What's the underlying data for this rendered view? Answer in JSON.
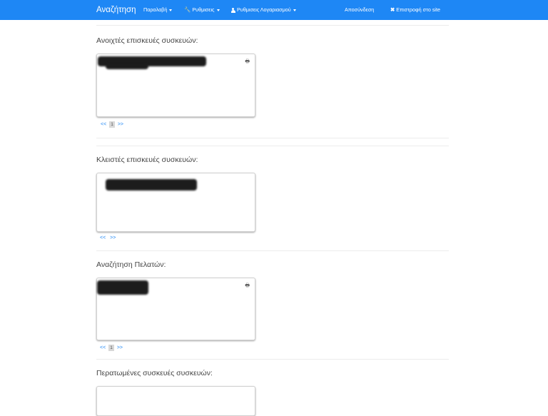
{
  "navbar": {
    "brand": "Αναζήτηση",
    "items": [
      {
        "label": "Παραλαβή"
      },
      {
        "label": "Ρυθμισεις",
        "icon": "wrench-icon"
      },
      {
        "label": "Ρυθμισεις Λογαριασμού",
        "icon": "user-icon"
      },
      {
        "label": "Αποσύνδεση"
      },
      {
        "label": "Επιστροφή στο site",
        "icon": "close-icon"
      }
    ],
    "color": "#1e87f5"
  },
  "sections": [
    {
      "title": "Ανοιχτές επισκευές συσκευών:",
      "pager": {
        "prev": "<<",
        "page": "1",
        "next": ">>"
      }
    },
    {
      "title": "Κλειστές επισκευές συσκευών:",
      "pager": {
        "prev": "<<",
        "next": ">>"
      }
    },
    {
      "title": "Αναζήτηση Πελατών:",
      "pager": {
        "prev": "<<",
        "page": "1",
        "next": ">>"
      }
    },
    {
      "title": "Περατωμένες συσκευές συσκευών:"
    }
  ]
}
